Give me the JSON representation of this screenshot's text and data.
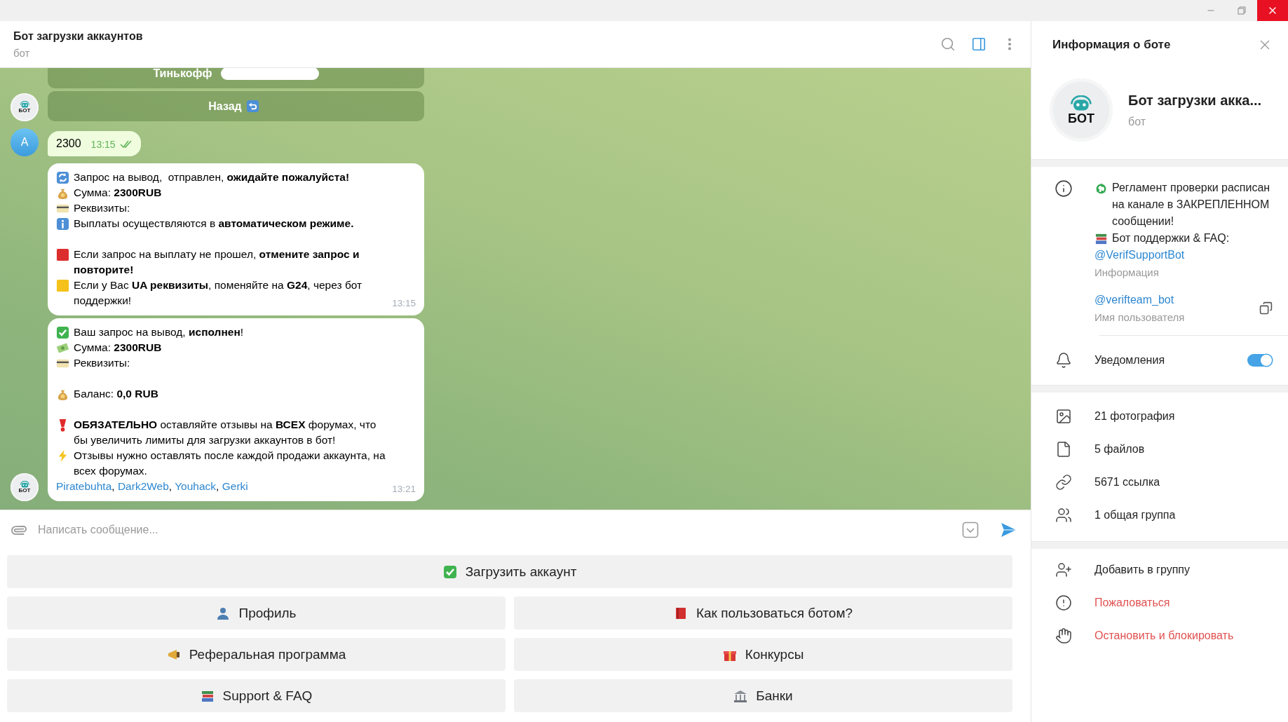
{
  "chat_header": {
    "title": "Бот загрузки аккаунтов",
    "subtitle": "бот",
    "actions": [
      {
        "kind": "search",
        "selected": false
      },
      {
        "kind": "sidebar",
        "selected": true
      },
      {
        "kind": "more",
        "selected": false
      }
    ]
  },
  "chat": {
    "groups": [
      {
        "avatar": {
          "kind": "bot",
          "label": "БОТ"
        },
        "items": [
          {
            "kind": "inline_button",
            "label": "Тинькофф",
            "redacted": true
          },
          {
            "kind": "inline_button",
            "label": "Назад",
            "emoji": {
              "kind": "back"
            }
          }
        ]
      },
      {
        "avatar": {
          "kind": "letter",
          "label": "A"
        },
        "items": [
          {
            "kind": "outgoing",
            "text": "2300",
            "time": "13:15",
            "read": true
          }
        ]
      },
      {
        "avatar": {
          "kind": "bot",
          "label": "БОТ"
        },
        "items": [
          {
            "kind": "incoming",
            "time": "13:15",
            "paragraphs": [
              [
                {
                  "kind": "refresh",
                  "text": "Запрос на вывод,  отправлен, **ожидайте пожалуйста!**"
                },
                {
                  "kind": "moneybag",
                  "text": "Сумма: **2300RUB**"
                },
                {
                  "kind": "card",
                  "text": "Реквизиты:"
                },
                {
                  "kind": "info",
                  "text": "Выплаты осуществляются в **автоматическом режиме.**"
                }
              ],
              [
                {
                  "kind": "red-square",
                  "text": "Если запрос на выплату не прошел, **отмените запрос и повторите!**"
                },
                {
                  "kind": "yellow-square",
                  "text": "Если у Вас **UA реквизиты**, поменяйте на **G24**, через бот поддержки!"
                }
              ]
            ]
          },
          {
            "kind": "incoming",
            "time": "13:21",
            "paragraphs": [
              [
                {
                  "kind": "check",
                  "text": "Ваш запрос на вывод, **исполнен**!"
                },
                {
                  "kind": "money",
                  "text": "Сумма: **2300RUB**"
                },
                {
                  "kind": "card",
                  "text": "Реквизиты:"
                }
              ],
              [
                {
                  "kind": "moneybag",
                  "text": "Баланс: **0,0 RUB**"
                }
              ],
              [
                {
                  "kind": "exclamation",
                  "text": "**ОБЯЗАТЕЛЬНО** оставляйте отзывы на **ВСЕХ** форумах, что бы увеличить лимиты для загрузки аккаунтов в бот!"
                },
                {
                  "kind": "zap",
                  "text": "Отзывы нужно оставлять после каждой продажи аккаунта, на всех форумах."
                }
              ]
            ],
            "links": [
              "Piratebuhta",
              "Dark2Web",
              "Youhack",
              "Gerki"
            ],
            "link_separator": ", "
          }
        ]
      }
    ]
  },
  "composer": {
    "placeholder": "Написать сообщение..."
  },
  "reply_keyboard": {
    "rows": [
      [
        {
          "kind": "check",
          "label": "Загрузить аккаунт"
        }
      ],
      [
        {
          "kind": "person",
          "label": "Профиль"
        },
        {
          "kind": "book",
          "label": "Как пользоваться ботом?"
        }
      ],
      [
        {
          "kind": "megaphone",
          "label": "Реферальная программа"
        },
        {
          "kind": "gift",
          "label": "Конкурсы"
        }
      ],
      [
        {
          "kind": "books",
          "label": "Support & FAQ"
        },
        {
          "kind": "bank",
          "label": "Банки"
        }
      ]
    ]
  },
  "info_panel": {
    "title": "Информация о боте",
    "profile": {
      "name": "Бот загрузки акка...",
      "subtitle": "бот",
      "avatar_label": "БОТ"
    },
    "about": [
      {
        "kind": "recycle",
        "text": "Регламент проверки расписан на канале в ЗАКРЕПЛЕННОМ сообщении!"
      },
      {
        "kind": "books",
        "text": "Бот поддержки & FAQ:"
      }
    ],
    "about_link": "@VerifSupportBot",
    "about_caption": "Информация",
    "username": {
      "value": "@verifteam_bot",
      "caption": "Имя пользователя"
    },
    "notifications": {
      "label": "Уведомления",
      "on": true
    },
    "media": [
      {
        "kind": "photos",
        "label": "21 фотография"
      },
      {
        "kind": "files",
        "label": "5 файлов"
      },
      {
        "kind": "links",
        "label": "5671 ссылка"
      },
      {
        "kind": "groups",
        "label": "1 общая группа"
      }
    ],
    "actions": [
      {
        "kind": "add",
        "label": "Добавить в группу",
        "danger": false
      },
      {
        "kind": "report",
        "label": "Пожаловаться",
        "danger": true
      },
      {
        "kind": "block",
        "label": "Остановить и блокировать",
        "danger": true
      }
    ]
  }
}
